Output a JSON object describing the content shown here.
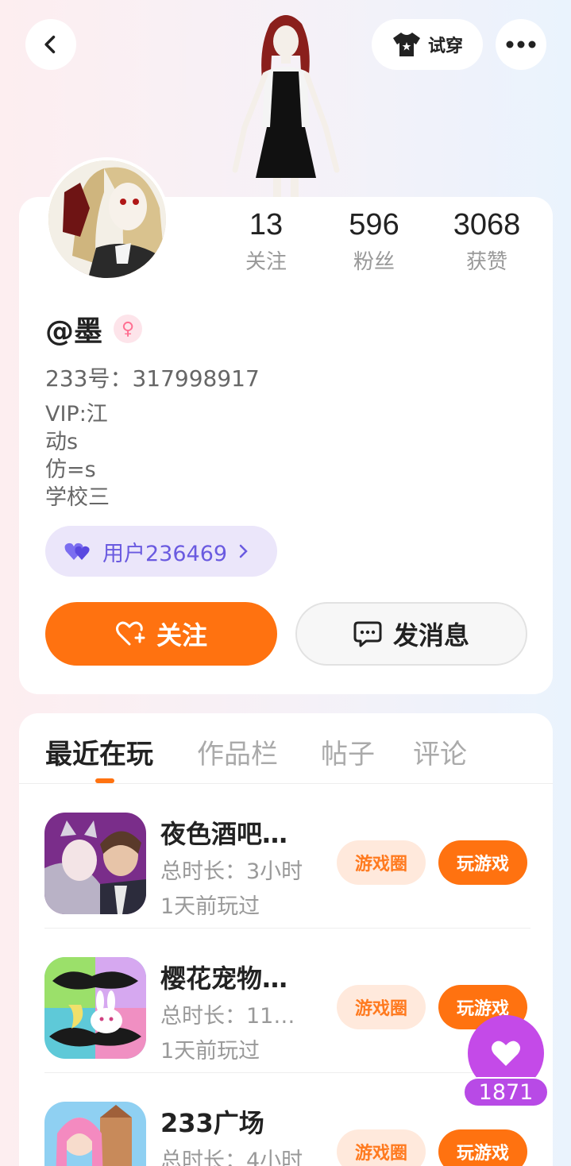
{
  "header": {
    "tryon_label": "试穿"
  },
  "profile": {
    "stats": [
      {
        "value": "13",
        "label": "关注"
      },
      {
        "value": "596",
        "label": "粉丝"
      },
      {
        "value": "3068",
        "label": "获赞"
      }
    ],
    "username": "@墨",
    "uid": "233号：317998917",
    "bio": [
      "VIP:江",
      "动s",
      "仿=s",
      "学校三"
    ],
    "guild_name": "用户236469",
    "follow_label": "关注",
    "message_label": "发消息"
  },
  "tabs": [
    {
      "label": "最近在玩",
      "active": true
    },
    {
      "label": "作品栏",
      "active": false
    },
    {
      "label": "帖子",
      "active": false
    },
    {
      "label": "评论",
      "active": false
    }
  ],
  "games": [
    {
      "name": "夜色酒吧…",
      "duration": "总时长：3小时",
      "last_played": "1天前玩过",
      "circle_label": "游戏圈",
      "play_label": "玩游戏"
    },
    {
      "name": "樱花宠物…",
      "duration": "总时长：11…",
      "last_played": "1天前玩过",
      "circle_label": "游戏圈",
      "play_label": "玩游戏"
    },
    {
      "name": "233广场",
      "duration": "总时长：4小时",
      "last_played": "",
      "circle_label": "游戏圈",
      "play_label": "玩游戏"
    }
  ],
  "like_float": {
    "count": "1871"
  },
  "colors": {
    "accent": "#ff7210",
    "guild_bg": "#ebe6fa",
    "guild_text": "#6a5ae0",
    "like_purple": "#c44ae8"
  }
}
